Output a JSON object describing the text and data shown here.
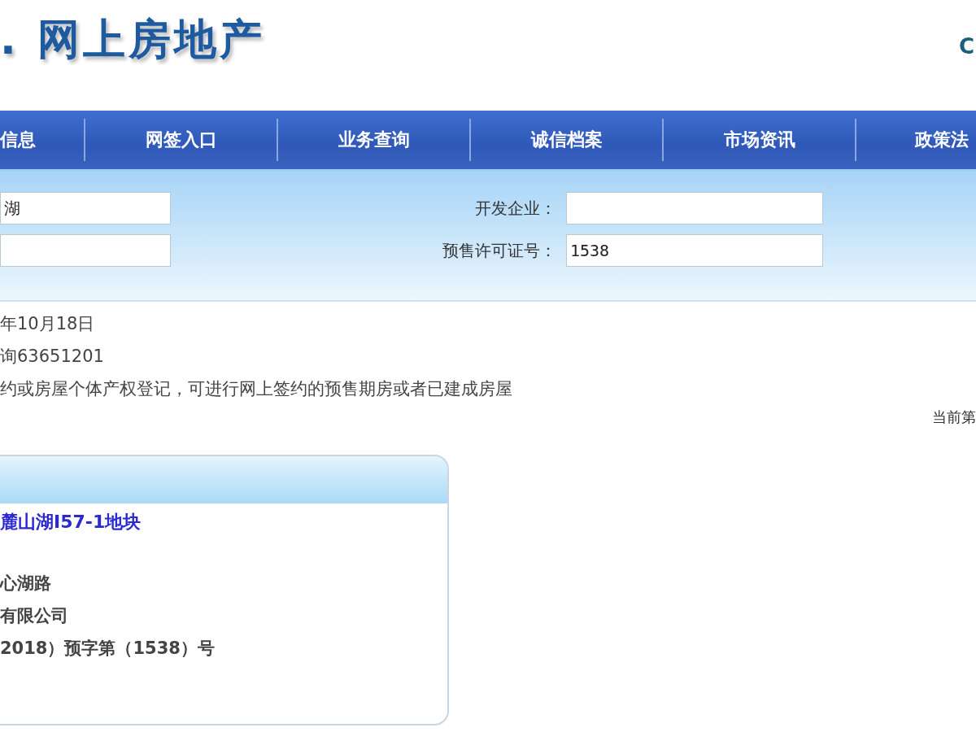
{
  "header": {
    "logo": ". 网上房地产",
    "corner_text": "C"
  },
  "nav": [
    {
      "label": "信息"
    },
    {
      "label": "网签入口"
    },
    {
      "label": "业务查询"
    },
    {
      "label": "诚信档案"
    },
    {
      "label": "市场资讯"
    },
    {
      "label": "政策法"
    }
  ],
  "search": {
    "left_fields": [
      {
        "kind": "input",
        "value": "湖"
      },
      {
        "kind": "input"
      }
    ],
    "right_fields": [
      {
        "label": "开发企业："
      },
      {
        "label": "预售许可证号：",
        "value": "1538"
      }
    ]
  },
  "notes": [
    "年10月18日",
    "询63651201",
    "约或房屋个体产权登记，可进行网上签约的预售期房或者已建成房屋"
  ],
  "page_indicator": "当前第",
  "project_card": {
    "title": "麓山湖I57-1地块",
    "lines": [
      "心湖路",
      "有限公司",
      "2018）预字第（1538）号"
    ]
  }
}
